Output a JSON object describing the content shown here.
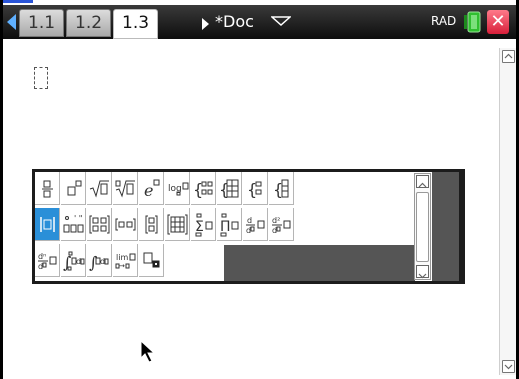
{
  "tabs": [
    {
      "label": "1.1",
      "active": false
    },
    {
      "label": "1.2",
      "active": false
    },
    {
      "label": "1.3",
      "active": true
    }
  ],
  "document": {
    "title": "*Doc"
  },
  "status": {
    "angle_mode": "RAD"
  },
  "colors": {
    "accent": "#2a8fd8",
    "close": "#d81f3a",
    "titlebar": "#1a1a1a"
  },
  "template_palette": {
    "rows": [
      [
        "fraction-template",
        "exponent-template",
        "square-root-template",
        "nth-root-template",
        "e-exponent-template",
        "log-template",
        "piecewise-2-template",
        "piecewise-n-template",
        "system-2-template",
        "system-n-template"
      ],
      [
        "absolute-value-template",
        "dms-template",
        "matrix-2x2-template",
        "row-matrix-template",
        "column-matrix-template",
        "matrix-mxn-template",
        "sum-template",
        "product-template",
        "first-derivative-template",
        "second-derivative-template"
      ],
      [
        "nth-derivative-template",
        "definite-integral-template",
        "indefinite-integral-template",
        "limit-template",
        "subscript-template"
      ]
    ],
    "selected": "absolute-value-template"
  },
  "icons": [
    "nav-left-icon",
    "nav-right-icon",
    "dropdown-caret-icon",
    "battery-icon",
    "close-icon",
    "scroll-up-icon",
    "scroll-down-icon",
    "pointer-cursor-icon"
  ]
}
